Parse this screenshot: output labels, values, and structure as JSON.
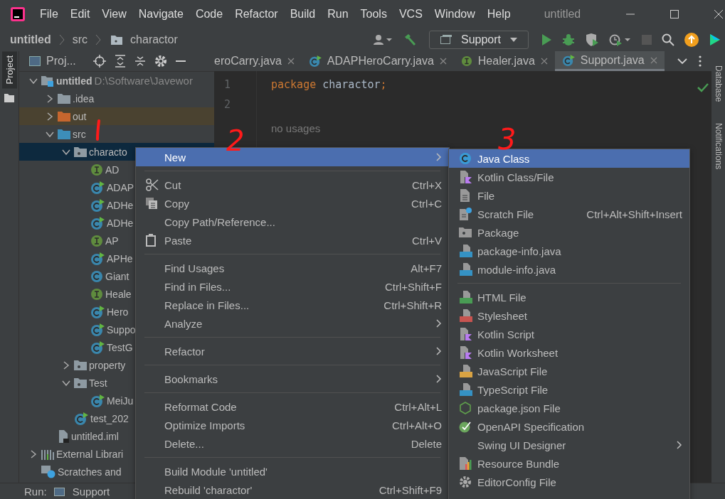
{
  "menu_bar": {
    "items": [
      "File",
      "Edit",
      "View",
      "Navigate",
      "Code",
      "Refactor",
      "Build",
      "Run",
      "Tools",
      "VCS",
      "Window",
      "Help"
    ],
    "title": "untitled"
  },
  "breadcrumbs": [
    "untitled",
    "src",
    "charactor"
  ],
  "run_config": "Support",
  "left_stripe": {
    "label": "Project"
  },
  "right_stripe": [
    "Database",
    "Notifications"
  ],
  "project_panel": {
    "title": "Proj..."
  },
  "editor_tabs": [
    {
      "label": "eroCarry.java",
      "selected": false,
      "kind": "runnable"
    },
    {
      "label": "ADAPHeroCarry.java",
      "selected": false,
      "kind": "runnable"
    },
    {
      "label": "Healer.java",
      "selected": false,
      "kind": "interface"
    },
    {
      "label": "Support.java",
      "selected": true,
      "kind": "runnable"
    }
  ],
  "tree": [
    {
      "label": "untitled",
      "path": "D:\\Software\\Javewor",
      "kind": "module",
      "expanded": true,
      "selected": false,
      "children": [
        {
          "label": ".idea",
          "kind": "folder",
          "expanded": false,
          "selected": false
        },
        {
          "label": "out",
          "kind": "excluded",
          "expanded": false,
          "selected": false
        },
        {
          "label": "src",
          "kind": "source",
          "expanded": true,
          "selected": false,
          "children": [
            {
              "label": "characto",
              "kind": "package",
              "expanded": true,
              "selected": true,
              "children": [
                {
                  "label": "AD",
                  "kind": "interface",
                  "selected": false
                },
                {
                  "label": "ADAP",
                  "kind": "runnable",
                  "selected": false
                },
                {
                  "label": "ADHe",
                  "kind": "runnable",
                  "selected": false
                },
                {
                  "label": "ADHe",
                  "kind": "runnable",
                  "selected": false
                },
                {
                  "label": "AP",
                  "kind": "interface",
                  "selected": false
                },
                {
                  "label": "APHe",
                  "kind": "runnable",
                  "selected": false
                },
                {
                  "label": "Giant",
                  "kind": "class",
                  "selected": false
                },
                {
                  "label": "Heale",
                  "kind": "interface",
                  "selected": false
                },
                {
                  "label": "Hero",
                  "kind": "runnable",
                  "selected": false
                },
                {
                  "label": "Suppo",
                  "kind": "runnable",
                  "selected": false
                },
                {
                  "label": "TestG",
                  "kind": "runnable",
                  "selected": false
                }
              ]
            },
            {
              "label": "property",
              "kind": "package",
              "expanded": false,
              "selected": false
            },
            {
              "label": "Test",
              "kind": "package",
              "expanded": true,
              "selected": false,
              "children": [
                {
                  "label": "MeiJu",
                  "kind": "runnable",
                  "selected": false
                }
              ]
            },
            {
              "label": "test_202",
              "kind": "runnable",
              "selected": false
            }
          ]
        },
        {
          "label": "untitled.iml",
          "kind": "iml",
          "selected": false
        }
      ]
    },
    {
      "label": "External Librari",
      "kind": "libraries",
      "expanded": false,
      "selected": false
    },
    {
      "label": "Scratches and",
      "kind": "scratches",
      "selected": false
    }
  ],
  "editor": {
    "lines": [
      {
        "number": "1",
        "segments": [
          {
            "text": "package",
            "kind": "keyword"
          },
          {
            "text": " charactor",
            "kind": "plain"
          },
          {
            "text": ";",
            "kind": "keyword"
          }
        ]
      },
      {
        "number": "2"
      }
    ],
    "hint": "no usages"
  },
  "context_menu": [
    [
      {
        "label": "New",
        "submenu": true,
        "selected": true
      }
    ],
    [
      {
        "label": "Cut",
        "shortcut": "Ctrl+X",
        "kind": "cut",
        "selected": false
      },
      {
        "label": "Copy",
        "shortcut": "Ctrl+C",
        "kind": "copy",
        "selected": false
      },
      {
        "label": "Copy Path/Reference...",
        "selected": false
      },
      {
        "label": "Paste",
        "shortcut": "Ctrl+V",
        "kind": "paste",
        "selected": false
      }
    ],
    [
      {
        "label": "Find Usages",
        "shortcut": "Alt+F7",
        "selected": false
      },
      {
        "label": "Find in Files...",
        "shortcut": "Ctrl+Shift+F",
        "selected": false
      },
      {
        "label": "Replace in Files...",
        "shortcut": "Ctrl+Shift+R",
        "selected": false
      },
      {
        "label": "Analyze",
        "submenu": true,
        "selected": false
      }
    ],
    [
      {
        "label": "Refactor",
        "submenu": true,
        "selected": false
      }
    ],
    [
      {
        "label": "Bookmarks",
        "submenu": true,
        "selected": false
      }
    ],
    [
      {
        "label": "Reformat Code",
        "shortcut": "Ctrl+Alt+L",
        "selected": false
      },
      {
        "label": "Optimize Imports",
        "shortcut": "Ctrl+Alt+O",
        "selected": false
      },
      {
        "label": "Delete...",
        "shortcut": "Delete",
        "selected": false
      }
    ],
    [
      {
        "label": "Build Module 'untitled'",
        "selected": false
      },
      {
        "label": "Rebuild 'charactor'",
        "shortcut": "Ctrl+Shift+F9",
        "selected": false
      }
    ]
  ],
  "new_submenu": [
    [
      {
        "label": "Java Class",
        "kind": "class",
        "selected": true
      },
      {
        "label": "Kotlin Class/File",
        "kind": "kotlin",
        "selected": false
      },
      {
        "label": "File",
        "kind": "file",
        "selected": false
      },
      {
        "label": "Scratch File",
        "shortcut": "Ctrl+Alt+Shift+Insert",
        "kind": "scratch",
        "selected": false
      },
      {
        "label": "Package",
        "kind": "package",
        "selected": false
      },
      {
        "label": "package-info.java",
        "kind": "java",
        "selected": false
      },
      {
        "label": "module-info.java",
        "kind": "java",
        "selected": false
      }
    ],
    [
      {
        "label": "HTML File",
        "kind": "html",
        "selected": false
      },
      {
        "label": "Stylesheet",
        "kind": "css",
        "selected": false
      },
      {
        "label": "Kotlin Script",
        "kind": "kotlin",
        "selected": false
      },
      {
        "label": "Kotlin Worksheet",
        "kind": "kotlin",
        "selected": false
      },
      {
        "label": "JavaScript File",
        "kind": "js",
        "selected": false
      },
      {
        "label": "TypeScript File",
        "kind": "ts",
        "selected": false
      },
      {
        "label": "package.json File",
        "kind": "npm",
        "selected": false
      },
      {
        "label": "OpenAPI Specification",
        "kind": "openapi",
        "selected": false
      },
      {
        "label": "Swing UI Designer",
        "submenu": true,
        "selected": false
      },
      {
        "label": "Resource Bundle",
        "kind": "bundle",
        "selected": false
      },
      {
        "label": "EditorConfig File",
        "kind": "gear",
        "selected": false
      }
    ]
  ],
  "run_bar": {
    "label": "Run:",
    "config": "Support"
  },
  "annotations": [
    "2",
    "3"
  ]
}
